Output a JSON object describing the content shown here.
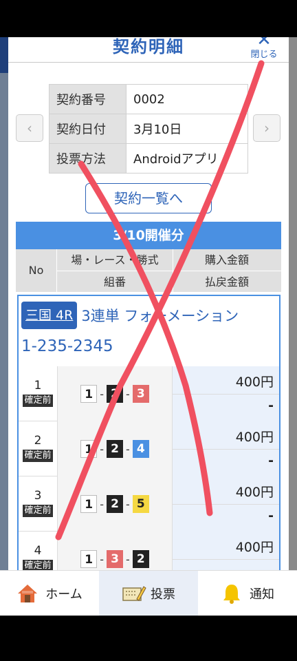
{
  "modal": {
    "title": "契約明細",
    "close_label": "閉じる",
    "prev_glyph": "‹",
    "next_glyph": "›"
  },
  "contract": {
    "rows": [
      {
        "key": "契約番号",
        "value": "0002"
      },
      {
        "key": "契約日付",
        "value": "3月10日"
      },
      {
        "key": "投票方法",
        "value": "Androidアプリ"
      }
    ]
  },
  "list_button": "契約一覧へ",
  "day_header": "3/10開催分",
  "columns": {
    "no": "No",
    "race": "場・レース・勝式",
    "purchase": "購入金額",
    "combo": "組番",
    "refund": "払戻金額"
  },
  "bet": {
    "venue": "三国 4R",
    "type": "3連単 フォーメーション",
    "code": "1-235-2345",
    "rows": [
      {
        "no": "1",
        "status": "確定前",
        "boats": [
          "1",
          "2",
          "3"
        ],
        "purchase": "400円",
        "payout": "-"
      },
      {
        "no": "2",
        "status": "確定前",
        "boats": [
          "1",
          "2",
          "4"
        ],
        "purchase": "400円",
        "payout": "-"
      },
      {
        "no": "3",
        "status": "確定前",
        "boats": [
          "1",
          "2",
          "5"
        ],
        "purchase": "400円",
        "payout": "-"
      },
      {
        "no": "4",
        "status": "確定前",
        "boats": [
          "1",
          "3",
          "2"
        ],
        "purchase": "400円",
        "payout": ""
      }
    ]
  },
  "nav": {
    "home": "ホーム",
    "vote": "投票",
    "notify": "通知"
  },
  "colors": {
    "accent": "#2e64b8",
    "header_blue": "#4a90e2",
    "overlay_red": "#f05060"
  },
  "icons": [
    "home-icon",
    "ticket-pencil-icon",
    "bell-icon"
  ]
}
